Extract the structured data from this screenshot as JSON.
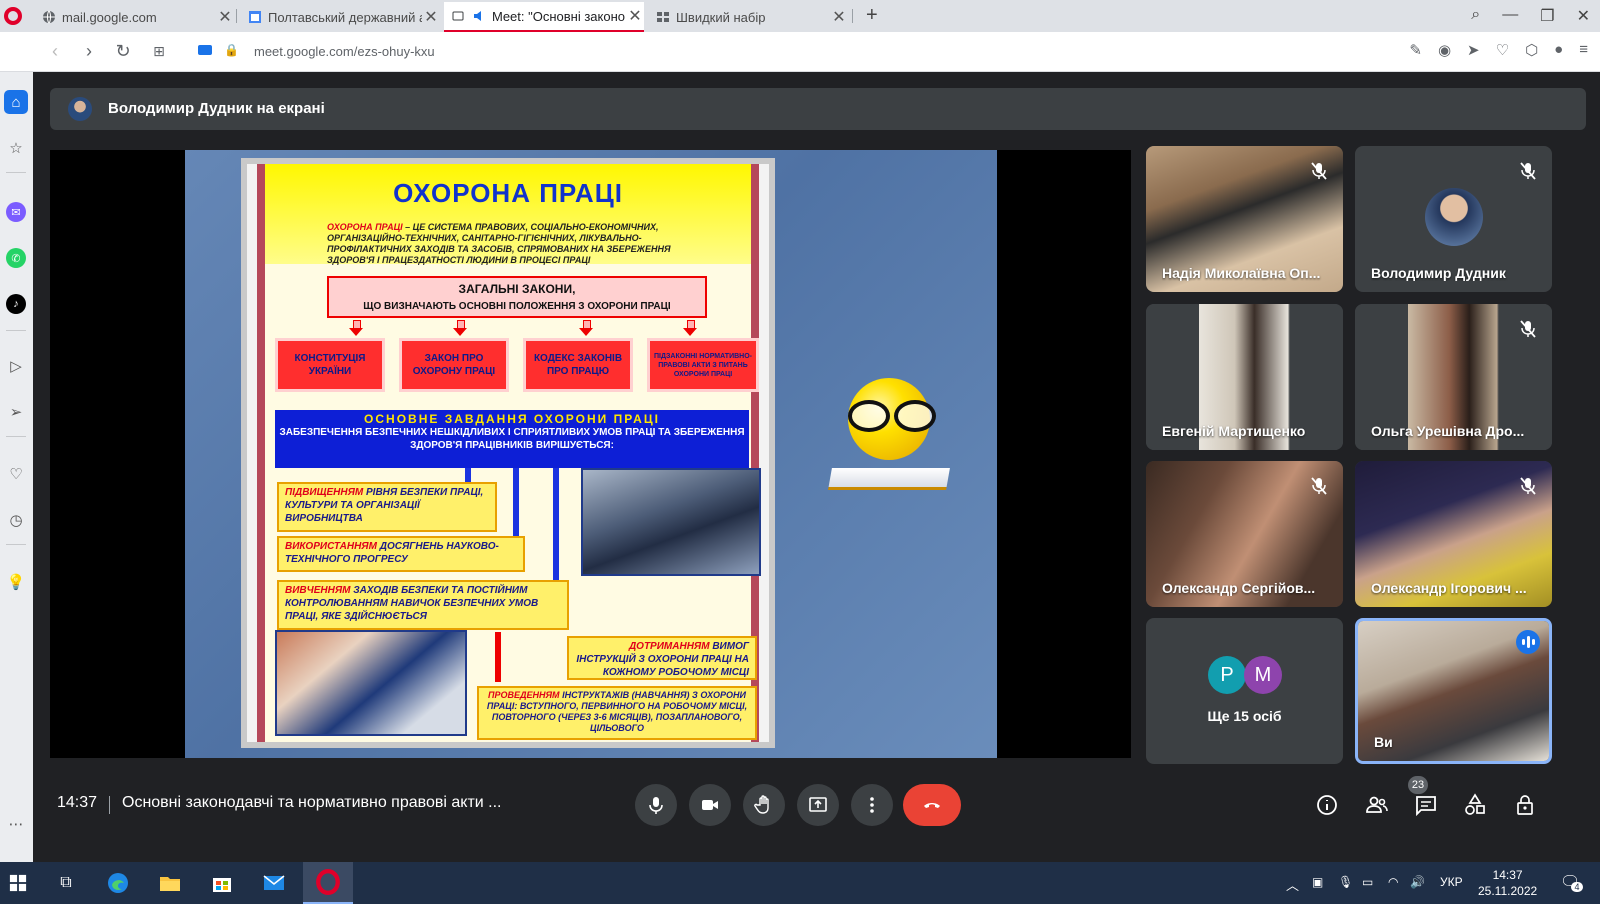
{
  "browser": {
    "tabs": [
      {
        "title": "mail.google.com",
        "active": false
      },
      {
        "title": "Полтавський державний а",
        "active": false
      },
      {
        "title": "Meet: \"Основні законо",
        "active": true
      },
      {
        "title": "Швидкий набір",
        "active": false
      }
    ],
    "url": "meet.google.com/ezs-ohuy-kxu"
  },
  "meet": {
    "presenter_label": "Володимир Дудник на екрані",
    "slide": {
      "title": "ОХОРОНА ПРАЦІ",
      "definition_lead": "ОХОРОНА ПРАЦІ",
      "definition_rest": " – ЦЕ СИСТЕМА ПРАВОВИХ, СОЦІАЛЬНО-ЕКОНОМІЧНИХ, ОРГАНІЗАЦІЙНО-ТЕХНІЧНИХ, САНІТАРНО-ГІГІЄНІЧНИХ, ЛІКУВАЛЬНО-ПРОФІЛАКТИЧНИХ ЗАХОДІВ ТА ЗАСОБІВ, СПРЯМОВАНИХ НА ЗБЕРЕЖЕННЯ ЗДОРОВ'Я І ПРАЦЕЗДАТНОСТІ ЛЮДИНИ В ПРОЦЕСІ ПРАЦІ",
      "laws_header_1": "ЗАГАЛЬНІ ЗАКОНИ,",
      "laws_header_2": "ЩО ВИЗНАЧАЮТЬ ОСНОВНІ ПОЛОЖЕННЯ З ОХОРОНИ ПРАЦІ",
      "laws": [
        "КОНСТИТУЦІЯ УКРАЇНИ",
        "ЗАКОН ПРО ОХОРОНУ ПРАЦІ",
        "КОДЕКС ЗАКОНІВ ПРО ПРАЦЮ",
        "ПІДЗАКОННІ НОРМАТИВНО-ПРАВОВІ АКТИ З ПИТАНЬ ОХОРОНИ ПРАЦІ"
      ],
      "task_title": "ОСНОВНЕ ЗАВДАННЯ ОХОРОНИ ПРАЦІ",
      "task_text": "ЗАБЕЗПЕЧЕННЯ БЕЗПЕЧНИХ НЕШКІДЛИВИХ І СПРИЯТЛИВИХ УМОВ ПРАЦІ ТА ЗБЕРЕЖЕННЯ ЗДОРОВ'Я ПРАЦІВНИКІВ ВИРІШУЄТЬСЯ:",
      "steps": [
        {
          "lead": "ПІДВИЩЕННЯМ",
          "rest": " РІВНЯ БЕЗПЕКИ ПРАЦІ, КУЛЬТУРИ ТА ОРГАНІЗАЦІЇ ВИРОБНИЦТВА"
        },
        {
          "lead": "ВИКОРИСТАННЯМ",
          "rest": " ДОСЯГНЕНЬ НАУКОВО-ТЕХНІЧНОГО ПРОГРЕСУ"
        },
        {
          "lead": "ВИВЧЕННЯМ",
          "rest": " ЗАХОДІВ БЕЗПЕКИ ТА ПОСТІЙНИМ КОНТРОЛЮВАННЯМ НАВИЧОК БЕЗПЕЧНИХ УМОВ ПРАЦІ, ЯКЕ ЗДІЙСНЮЄТЬСЯ"
        },
        {
          "lead": "ДОТРИМАННЯМ",
          "rest": " ВИМОГ ІНСТРУКЦІЙ З ОХОРОНИ ПРАЦІ НА КОЖНОМУ РОБОЧОМУ МІСЦІ"
        },
        {
          "lead": "ПРОВЕДЕННЯМ",
          "rest": " ІНСТРУКТАЖІВ (НАВЧАННЯ) З ОХОРОНИ ПРАЦІ: ВСТУПНОГО, ПЕРВИННОГО НА РОБОЧОМУ МІСЦІ, ПОВТОРНОГО (ЧЕРЕЗ 3-6 МІСЯЦІВ), ПОЗАПЛАНОВОГО, ЦІЛЬОВОГО"
        }
      ]
    },
    "participants": [
      {
        "name": "Надія Миколаївна Оп...",
        "muted": true
      },
      {
        "name": "Володимир Дудник",
        "muted": true
      },
      {
        "name": "Евгеній Мартищенко",
        "muted": false
      },
      {
        "name": "Ольга Урешівна Дро...",
        "muted": true
      },
      {
        "name": "Олександр Сергійов...",
        "muted": true
      },
      {
        "name": "Олександр Ігорович ...",
        "muted": true
      }
    ],
    "more": {
      "initials": [
        "Р",
        "М"
      ],
      "label": "Ще 15 осіб"
    },
    "self": {
      "name": "Ви"
    },
    "clock": "14:37",
    "meeting_title": "Основні законодавчі та нормативно правові акти ...",
    "participant_count": "23"
  },
  "taskbar": {
    "language": "УКР",
    "time": "14:37",
    "date": "25.11.2022",
    "notifications": "4"
  },
  "colors": {
    "accent": "#1a73e8",
    "end_call": "#ea4335",
    "opera_red": "#e0002a"
  }
}
